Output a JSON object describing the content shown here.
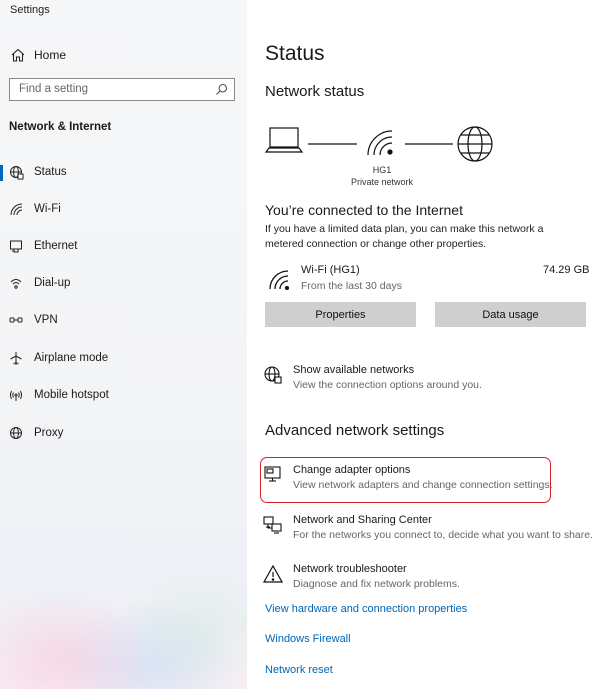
{
  "app": {
    "title": "Settings"
  },
  "sidebar": {
    "home_label": "Home",
    "search_placeholder": "Find a setting",
    "section_title": "Network & Internet",
    "items": [
      {
        "label": "Status",
        "icon": "globe-status-icon",
        "active": true
      },
      {
        "label": "Wi-Fi",
        "icon": "wifi-icon"
      },
      {
        "label": "Ethernet",
        "icon": "ethernet-icon"
      },
      {
        "label": "Dial-up",
        "icon": "dialup-icon"
      },
      {
        "label": "VPN",
        "icon": "vpn-icon"
      },
      {
        "label": "Airplane mode",
        "icon": "airplane-icon"
      },
      {
        "label": "Mobile hotspot",
        "icon": "hotspot-icon"
      },
      {
        "label": "Proxy",
        "icon": "globe-icon"
      }
    ]
  },
  "main": {
    "title": "Status",
    "network_status_heading": "Network status",
    "network_name": "HG1",
    "network_type": "Private network",
    "connected_heading": "You’re connected to the Internet",
    "connected_desc": "If you have a limited data plan, you can make this network a metered connection or change other properties.",
    "wifi": {
      "name": "Wi-Fi (HG1)",
      "sub": "From the last 30 days",
      "usage": "74.29 GB"
    },
    "buttons": {
      "properties": "Properties",
      "data_usage": "Data usage"
    },
    "show_networks": {
      "title": "Show available networks",
      "sub": "View the connection options around you."
    },
    "advanced_heading": "Advanced network settings",
    "advanced_options": [
      {
        "title": "Change adapter options",
        "sub": "View network adapters and change connection settings."
      },
      {
        "title": "Network and Sharing Center",
        "sub": "For the networks you connect to, decide what you want to share."
      },
      {
        "title": "Network troubleshooter",
        "sub": "Diagnose and fix network problems."
      }
    ],
    "links": [
      "View hardware and connection properties",
      "Windows Firewall",
      "Network reset"
    ]
  },
  "colors": {
    "accent": "#0066b4",
    "highlight": "#d8202a",
    "button": "#cfcfcf"
  }
}
